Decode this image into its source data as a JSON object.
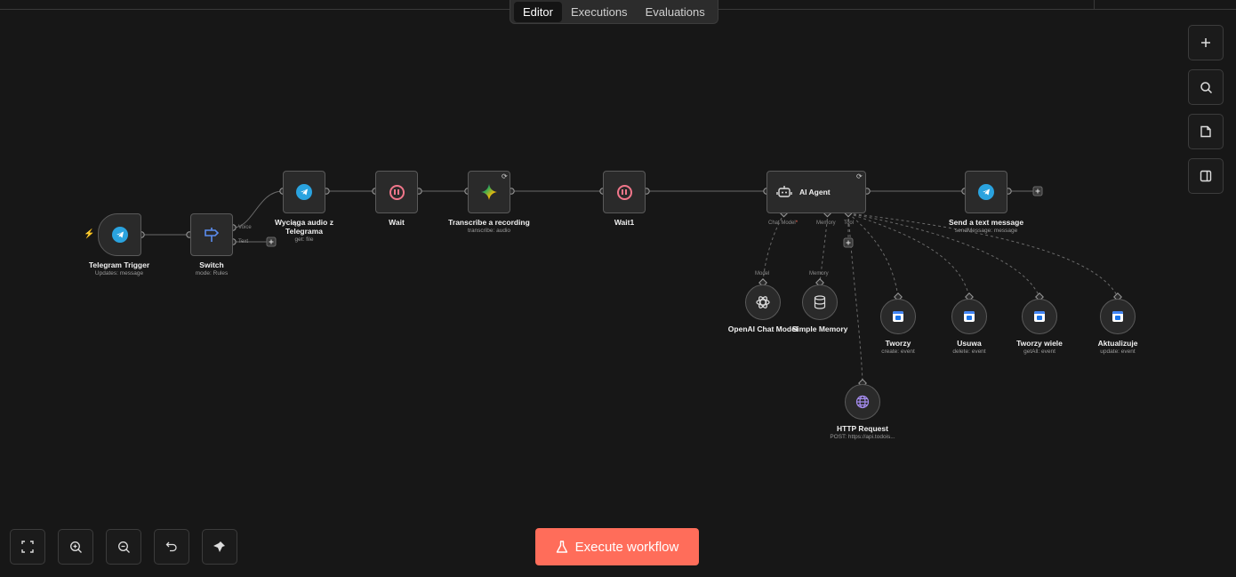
{
  "tabs": [
    {
      "label": "Editor",
      "active": true
    },
    {
      "label": "Executions",
      "active": false
    },
    {
      "label": "Evaluations",
      "active": false
    }
  ],
  "right_toolbar": [
    "plus-icon",
    "search-icon",
    "sticky-note-icon",
    "panel-icon"
  ],
  "bottom_toolbar": [
    "fit-view-icon",
    "zoom-in-icon",
    "zoom-out-icon",
    "undo-icon",
    "tidy-up-icon"
  ],
  "execute": {
    "label": "Execute workflow",
    "icon": "flask-icon",
    "color": "#ff6d5a"
  },
  "nodes": {
    "telegram_trigger": {
      "title": "Telegram Trigger",
      "subtitle": "Updates: message"
    },
    "switch": {
      "title": "Switch",
      "subtitle": "mode: Rules",
      "out_voice": "Voice",
      "out_text": "Text"
    },
    "download_audio": {
      "title": "Wyciąga audio z Telegrama",
      "subtitle": "get: file"
    },
    "wait": {
      "title": "Wait"
    },
    "transcribe": {
      "title": "Transcribe a recording",
      "subtitle": "transcribe: audio"
    },
    "wait1": {
      "title": "Wait1"
    },
    "agent": {
      "title": "AI Agent",
      "port_chat_model": "Chat Model",
      "port_required": "*",
      "port_memory": "Memory",
      "port_tool": "Tool"
    },
    "send_message": {
      "title": "Send a text message",
      "subtitle": "sendMessage: message"
    },
    "openai": {
      "title": "OpenAI Chat Model",
      "top_label": "Model"
    },
    "memory": {
      "title": "Simple Memory",
      "top_label": "Memory"
    },
    "tworzy": {
      "title": "Tworzy",
      "subtitle": "create: event"
    },
    "usuwa": {
      "title": "Usuwa",
      "subtitle": "delete: event"
    },
    "tworzy_wiele": {
      "title": "Tworzy wiele",
      "subtitle": "getAll: event"
    },
    "aktualizuje": {
      "title": "Aktualizuje",
      "subtitle": "update: event"
    },
    "http": {
      "title": "HTTP Request",
      "subtitle": "POST: https://api.todois..."
    }
  },
  "colors": {
    "telegram": "#2aa3df",
    "wait": "#f0768a",
    "switch": "#5b8def",
    "accent": "#ff6d5a"
  }
}
